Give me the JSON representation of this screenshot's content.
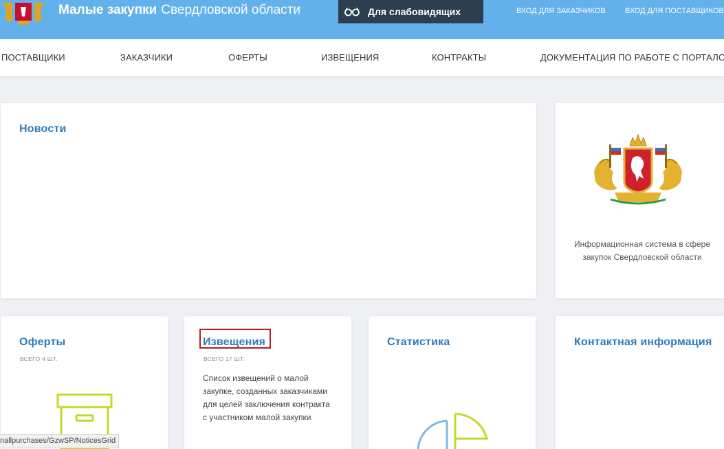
{
  "header": {
    "brand_bold": "Малые закупки",
    "brand_light": "Свердловской области",
    "vision_label": "Для слабовидящих",
    "login_customer": "вход для заказчиков",
    "login_supplier": "вход для поставщиков"
  },
  "nav": {
    "items": [
      {
        "label": "ПОСТАВЩИКИ"
      },
      {
        "label": "ЗАКАЗЧИКИ"
      },
      {
        "label": "ОФЕРТЫ"
      },
      {
        "label": "ИЗВЕЩЕНИЯ"
      },
      {
        "label": "КОНТРАКТЫ"
      },
      {
        "label": "ДОКУМЕНТАЦИЯ ПО РАБОТЕ С ПОРТАЛОМ"
      }
    ]
  },
  "news": {
    "title": "Новости"
  },
  "info": {
    "text": "Информационная система в сфере закупок Свердловской области"
  },
  "offers": {
    "title": "Оферты",
    "count": "ВСЕГО 4 ШТ."
  },
  "notices": {
    "title": "Извещения",
    "count": "ВСЕГО 17 ШТ.",
    "description": "Список извещений о малой закупке, созданных заказчиками для целей заключения контракта с участником малой закупки"
  },
  "stats": {
    "title": "Статистика"
  },
  "contacts": {
    "title": "Контактная информация"
  },
  "status_bar": {
    "url": "nallpurchases/GzwSP/NoticesGrid"
  },
  "colors": {
    "header_bg": "#62b1ea",
    "vision_bg": "#2c3e50",
    "link_blue": "#2d7ab8",
    "icon_green": "#c5d82a",
    "icon_blue": "#7fb8e6",
    "highlight_red": "#b01e23"
  }
}
